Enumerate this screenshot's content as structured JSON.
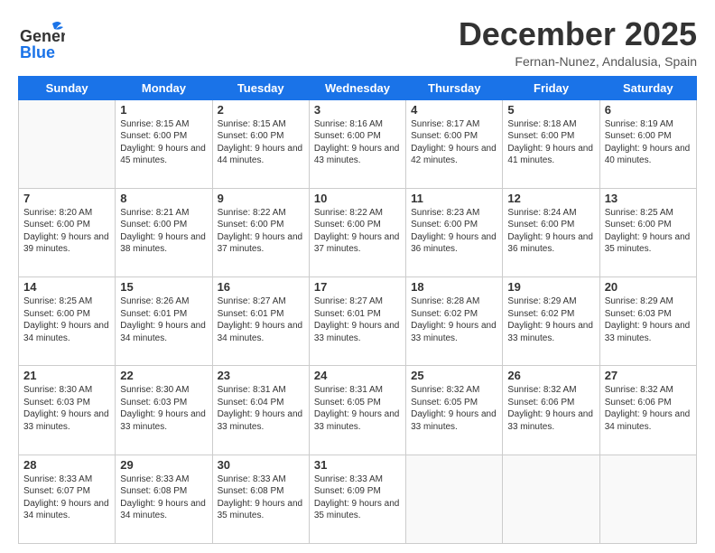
{
  "header": {
    "logo_general": "General",
    "logo_blue": "Blue",
    "month_title": "December 2025",
    "subtitle": "Fernan-Nunez, Andalusia, Spain"
  },
  "weekdays": [
    "Sunday",
    "Monday",
    "Tuesday",
    "Wednesday",
    "Thursday",
    "Friday",
    "Saturday"
  ],
  "weeks": [
    [
      {
        "day": "",
        "sunrise": "",
        "sunset": "",
        "daylight": ""
      },
      {
        "day": "1",
        "sunrise": "Sunrise: 8:15 AM",
        "sunset": "Sunset: 6:00 PM",
        "daylight": "Daylight: 9 hours and 45 minutes."
      },
      {
        "day": "2",
        "sunrise": "Sunrise: 8:15 AM",
        "sunset": "Sunset: 6:00 PM",
        "daylight": "Daylight: 9 hours and 44 minutes."
      },
      {
        "day": "3",
        "sunrise": "Sunrise: 8:16 AM",
        "sunset": "Sunset: 6:00 PM",
        "daylight": "Daylight: 9 hours and 43 minutes."
      },
      {
        "day": "4",
        "sunrise": "Sunrise: 8:17 AM",
        "sunset": "Sunset: 6:00 PM",
        "daylight": "Daylight: 9 hours and 42 minutes."
      },
      {
        "day": "5",
        "sunrise": "Sunrise: 8:18 AM",
        "sunset": "Sunset: 6:00 PM",
        "daylight": "Daylight: 9 hours and 41 minutes."
      },
      {
        "day": "6",
        "sunrise": "Sunrise: 8:19 AM",
        "sunset": "Sunset: 6:00 PM",
        "daylight": "Daylight: 9 hours and 40 minutes."
      }
    ],
    [
      {
        "day": "7",
        "sunrise": "Sunrise: 8:20 AM",
        "sunset": "Sunset: 6:00 PM",
        "daylight": "Daylight: 9 hours and 39 minutes."
      },
      {
        "day": "8",
        "sunrise": "Sunrise: 8:21 AM",
        "sunset": "Sunset: 6:00 PM",
        "daylight": "Daylight: 9 hours and 38 minutes."
      },
      {
        "day": "9",
        "sunrise": "Sunrise: 8:22 AM",
        "sunset": "Sunset: 6:00 PM",
        "daylight": "Daylight: 9 hours and 37 minutes."
      },
      {
        "day": "10",
        "sunrise": "Sunrise: 8:22 AM",
        "sunset": "Sunset: 6:00 PM",
        "daylight": "Daylight: 9 hours and 37 minutes."
      },
      {
        "day": "11",
        "sunrise": "Sunrise: 8:23 AM",
        "sunset": "Sunset: 6:00 PM",
        "daylight": "Daylight: 9 hours and 36 minutes."
      },
      {
        "day": "12",
        "sunrise": "Sunrise: 8:24 AM",
        "sunset": "Sunset: 6:00 PM",
        "daylight": "Daylight: 9 hours and 36 minutes."
      },
      {
        "day": "13",
        "sunrise": "Sunrise: 8:25 AM",
        "sunset": "Sunset: 6:00 PM",
        "daylight": "Daylight: 9 hours and 35 minutes."
      }
    ],
    [
      {
        "day": "14",
        "sunrise": "Sunrise: 8:25 AM",
        "sunset": "Sunset: 6:00 PM",
        "daylight": "Daylight: 9 hours and 34 minutes."
      },
      {
        "day": "15",
        "sunrise": "Sunrise: 8:26 AM",
        "sunset": "Sunset: 6:01 PM",
        "daylight": "Daylight: 9 hours and 34 minutes."
      },
      {
        "day": "16",
        "sunrise": "Sunrise: 8:27 AM",
        "sunset": "Sunset: 6:01 PM",
        "daylight": "Daylight: 9 hours and 34 minutes."
      },
      {
        "day": "17",
        "sunrise": "Sunrise: 8:27 AM",
        "sunset": "Sunset: 6:01 PM",
        "daylight": "Daylight: 9 hours and 33 minutes."
      },
      {
        "day": "18",
        "sunrise": "Sunrise: 8:28 AM",
        "sunset": "Sunset: 6:02 PM",
        "daylight": "Daylight: 9 hours and 33 minutes."
      },
      {
        "day": "19",
        "sunrise": "Sunrise: 8:29 AM",
        "sunset": "Sunset: 6:02 PM",
        "daylight": "Daylight: 9 hours and 33 minutes."
      },
      {
        "day": "20",
        "sunrise": "Sunrise: 8:29 AM",
        "sunset": "Sunset: 6:03 PM",
        "daylight": "Daylight: 9 hours and 33 minutes."
      }
    ],
    [
      {
        "day": "21",
        "sunrise": "Sunrise: 8:30 AM",
        "sunset": "Sunset: 6:03 PM",
        "daylight": "Daylight: 9 hours and 33 minutes."
      },
      {
        "day": "22",
        "sunrise": "Sunrise: 8:30 AM",
        "sunset": "Sunset: 6:03 PM",
        "daylight": "Daylight: 9 hours and 33 minutes."
      },
      {
        "day": "23",
        "sunrise": "Sunrise: 8:31 AM",
        "sunset": "Sunset: 6:04 PM",
        "daylight": "Daylight: 9 hours and 33 minutes."
      },
      {
        "day": "24",
        "sunrise": "Sunrise: 8:31 AM",
        "sunset": "Sunset: 6:05 PM",
        "daylight": "Daylight: 9 hours and 33 minutes."
      },
      {
        "day": "25",
        "sunrise": "Sunrise: 8:32 AM",
        "sunset": "Sunset: 6:05 PM",
        "daylight": "Daylight: 9 hours and 33 minutes."
      },
      {
        "day": "26",
        "sunrise": "Sunrise: 8:32 AM",
        "sunset": "Sunset: 6:06 PM",
        "daylight": "Daylight: 9 hours and 33 minutes."
      },
      {
        "day": "27",
        "sunrise": "Sunrise: 8:32 AM",
        "sunset": "Sunset: 6:06 PM",
        "daylight": "Daylight: 9 hours and 34 minutes."
      }
    ],
    [
      {
        "day": "28",
        "sunrise": "Sunrise: 8:33 AM",
        "sunset": "Sunset: 6:07 PM",
        "daylight": "Daylight: 9 hours and 34 minutes."
      },
      {
        "day": "29",
        "sunrise": "Sunrise: 8:33 AM",
        "sunset": "Sunset: 6:08 PM",
        "daylight": "Daylight: 9 hours and 34 minutes."
      },
      {
        "day": "30",
        "sunrise": "Sunrise: 8:33 AM",
        "sunset": "Sunset: 6:08 PM",
        "daylight": "Daylight: 9 hours and 35 minutes."
      },
      {
        "day": "31",
        "sunrise": "Sunrise: 8:33 AM",
        "sunset": "Sunset: 6:09 PM",
        "daylight": "Daylight: 9 hours and 35 minutes."
      },
      {
        "day": "",
        "sunrise": "",
        "sunset": "",
        "daylight": ""
      },
      {
        "day": "",
        "sunrise": "",
        "sunset": "",
        "daylight": ""
      },
      {
        "day": "",
        "sunrise": "",
        "sunset": "",
        "daylight": ""
      }
    ]
  ]
}
